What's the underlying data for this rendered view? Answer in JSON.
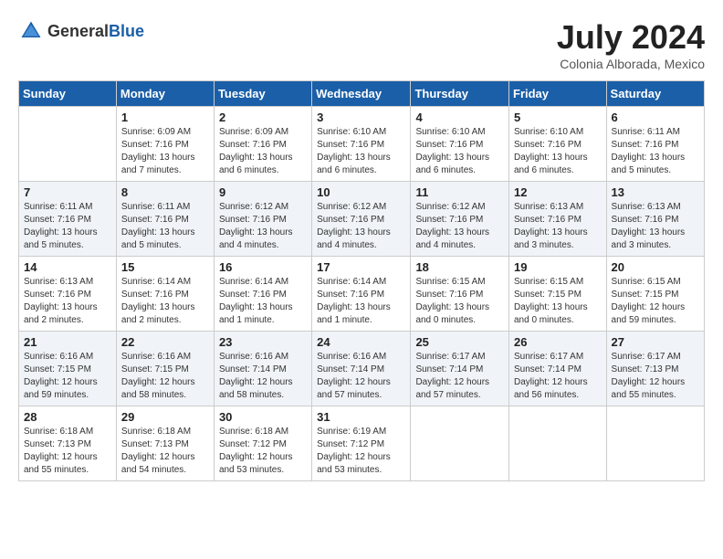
{
  "logo": {
    "text_general": "General",
    "text_blue": "Blue"
  },
  "header": {
    "month_year": "July 2024",
    "location": "Colonia Alborada, Mexico"
  },
  "days_of_week": [
    "Sunday",
    "Monday",
    "Tuesday",
    "Wednesday",
    "Thursday",
    "Friday",
    "Saturday"
  ],
  "weeks": [
    [
      {
        "day": "",
        "info": ""
      },
      {
        "day": "1",
        "info": "Sunrise: 6:09 AM\nSunset: 7:16 PM\nDaylight: 13 hours\nand 7 minutes."
      },
      {
        "day": "2",
        "info": "Sunrise: 6:09 AM\nSunset: 7:16 PM\nDaylight: 13 hours\nand 6 minutes."
      },
      {
        "day": "3",
        "info": "Sunrise: 6:10 AM\nSunset: 7:16 PM\nDaylight: 13 hours\nand 6 minutes."
      },
      {
        "day": "4",
        "info": "Sunrise: 6:10 AM\nSunset: 7:16 PM\nDaylight: 13 hours\nand 6 minutes."
      },
      {
        "day": "5",
        "info": "Sunrise: 6:10 AM\nSunset: 7:16 PM\nDaylight: 13 hours\nand 6 minutes."
      },
      {
        "day": "6",
        "info": "Sunrise: 6:11 AM\nSunset: 7:16 PM\nDaylight: 13 hours\nand 5 minutes."
      }
    ],
    [
      {
        "day": "7",
        "info": "Sunrise: 6:11 AM\nSunset: 7:16 PM\nDaylight: 13 hours\nand 5 minutes."
      },
      {
        "day": "8",
        "info": "Sunrise: 6:11 AM\nSunset: 7:16 PM\nDaylight: 13 hours\nand 5 minutes."
      },
      {
        "day": "9",
        "info": "Sunrise: 6:12 AM\nSunset: 7:16 PM\nDaylight: 13 hours\nand 4 minutes."
      },
      {
        "day": "10",
        "info": "Sunrise: 6:12 AM\nSunset: 7:16 PM\nDaylight: 13 hours\nand 4 minutes."
      },
      {
        "day": "11",
        "info": "Sunrise: 6:12 AM\nSunset: 7:16 PM\nDaylight: 13 hours\nand 4 minutes."
      },
      {
        "day": "12",
        "info": "Sunrise: 6:13 AM\nSunset: 7:16 PM\nDaylight: 13 hours\nand 3 minutes."
      },
      {
        "day": "13",
        "info": "Sunrise: 6:13 AM\nSunset: 7:16 PM\nDaylight: 13 hours\nand 3 minutes."
      }
    ],
    [
      {
        "day": "14",
        "info": "Sunrise: 6:13 AM\nSunset: 7:16 PM\nDaylight: 13 hours\nand 2 minutes."
      },
      {
        "day": "15",
        "info": "Sunrise: 6:14 AM\nSunset: 7:16 PM\nDaylight: 13 hours\nand 2 minutes."
      },
      {
        "day": "16",
        "info": "Sunrise: 6:14 AM\nSunset: 7:16 PM\nDaylight: 13 hours\nand 1 minute."
      },
      {
        "day": "17",
        "info": "Sunrise: 6:14 AM\nSunset: 7:16 PM\nDaylight: 13 hours\nand 1 minute."
      },
      {
        "day": "18",
        "info": "Sunrise: 6:15 AM\nSunset: 7:16 PM\nDaylight: 13 hours\nand 0 minutes."
      },
      {
        "day": "19",
        "info": "Sunrise: 6:15 AM\nSunset: 7:15 PM\nDaylight: 13 hours\nand 0 minutes."
      },
      {
        "day": "20",
        "info": "Sunrise: 6:15 AM\nSunset: 7:15 PM\nDaylight: 12 hours\nand 59 minutes."
      }
    ],
    [
      {
        "day": "21",
        "info": "Sunrise: 6:16 AM\nSunset: 7:15 PM\nDaylight: 12 hours\nand 59 minutes."
      },
      {
        "day": "22",
        "info": "Sunrise: 6:16 AM\nSunset: 7:15 PM\nDaylight: 12 hours\nand 58 minutes."
      },
      {
        "day": "23",
        "info": "Sunrise: 6:16 AM\nSunset: 7:14 PM\nDaylight: 12 hours\nand 58 minutes."
      },
      {
        "day": "24",
        "info": "Sunrise: 6:16 AM\nSunset: 7:14 PM\nDaylight: 12 hours\nand 57 minutes."
      },
      {
        "day": "25",
        "info": "Sunrise: 6:17 AM\nSunset: 7:14 PM\nDaylight: 12 hours\nand 57 minutes."
      },
      {
        "day": "26",
        "info": "Sunrise: 6:17 AM\nSunset: 7:14 PM\nDaylight: 12 hours\nand 56 minutes."
      },
      {
        "day": "27",
        "info": "Sunrise: 6:17 AM\nSunset: 7:13 PM\nDaylight: 12 hours\nand 55 minutes."
      }
    ],
    [
      {
        "day": "28",
        "info": "Sunrise: 6:18 AM\nSunset: 7:13 PM\nDaylight: 12 hours\nand 55 minutes."
      },
      {
        "day": "29",
        "info": "Sunrise: 6:18 AM\nSunset: 7:13 PM\nDaylight: 12 hours\nand 54 minutes."
      },
      {
        "day": "30",
        "info": "Sunrise: 6:18 AM\nSunset: 7:12 PM\nDaylight: 12 hours\nand 53 minutes."
      },
      {
        "day": "31",
        "info": "Sunrise: 6:19 AM\nSunset: 7:12 PM\nDaylight: 12 hours\nand 53 minutes."
      },
      {
        "day": "",
        "info": ""
      },
      {
        "day": "",
        "info": ""
      },
      {
        "day": "",
        "info": ""
      }
    ]
  ]
}
